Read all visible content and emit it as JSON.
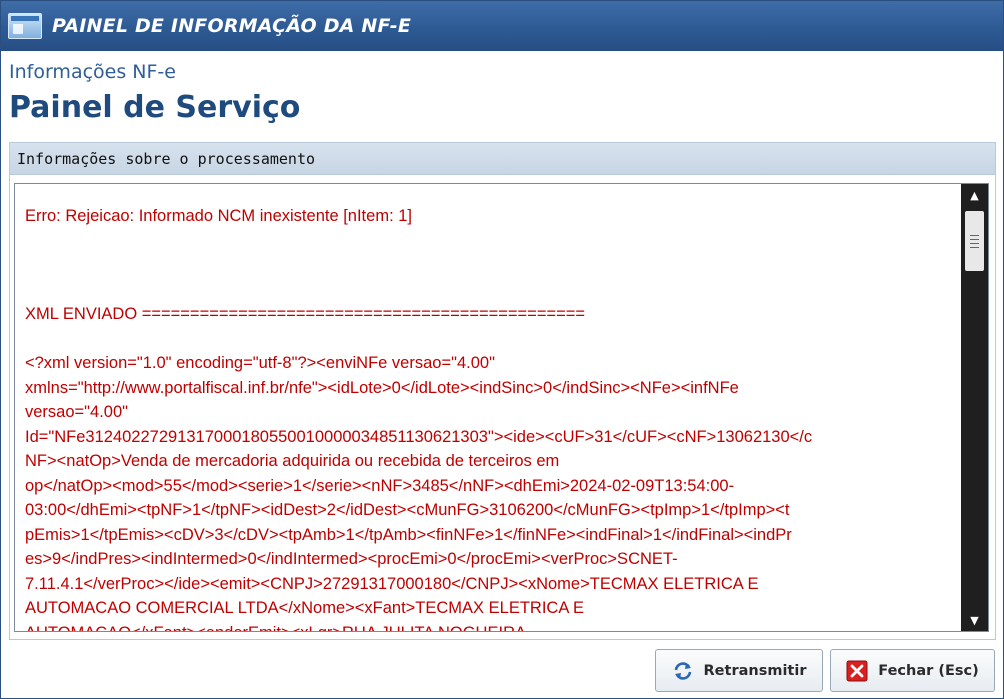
{
  "window": {
    "title": "PAINEL DE INFORMAÇÃO DA NF-E"
  },
  "header": {
    "subtitle": "Informações NF-e",
    "title": "Painel de Serviço"
  },
  "panel": {
    "title": "Informações sobre o processamento",
    "lines": [
      "Erro: Rejeicao: Informado NCM inexistente [nItem: 1]",
      "",
      "",
      "",
      "XML ENVIADO ==============================================",
      "",
      "<?xml version=\"1.0\" encoding=\"utf-8\"?><enviNFe versao=\"4.00\"",
      "xmlns=\"http://www.portalfiscal.inf.br/nfe\"><idLote>0</idLote><indSinc>0</indSinc><NFe><infNFe",
      "versao=\"4.00\"",
      "Id=\"NFe31240227291317000180550010000034851130621303\"><ide><cUF>31</cUF><cNF>13062130</c",
      "NF><natOp>Venda de mercadoria adquirida ou recebida de terceiros em",
      "op</natOp><mod>55</mod><serie>1</serie><nNF>3485</nNF><dhEmi>2024-02-09T13:54:00-",
      "03:00</dhEmi><tpNF>1</tpNF><idDest>2</idDest><cMunFG>3106200</cMunFG><tpImp>1</tpImp><t",
      "pEmis>1</tpEmis><cDV>3</cDV><tpAmb>1</tpAmb><finNFe>1</finNFe><indFinal>1</indFinal><indPr",
      "es>9</indPres><indIntermed>0</indIntermed><procEmi>0</procEmi><verProc>SCNET-",
      "7.11.4.1</verProc></ide><emit><CNPJ>27291317000180</CNPJ><xNome>TECMAX ELETRICA E",
      "AUTOMACAO COMERCIAL LTDA</xNome><xFant>TECMAX ELETRICA E",
      "AUTOMACAO</xFant><enderEmit><xLgr>RUA JULITA NOGUEIRA"
    ]
  },
  "buttons": {
    "retransmit": "Retransmitir",
    "close": "Fechar (Esc)"
  }
}
